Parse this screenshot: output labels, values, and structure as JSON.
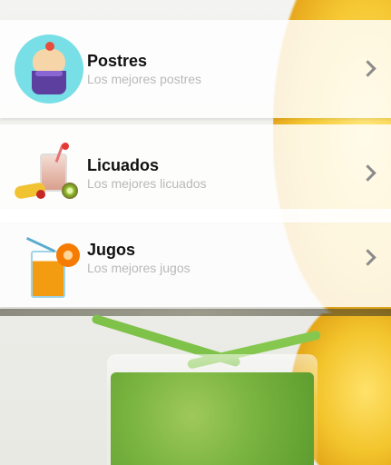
{
  "categories": [
    {
      "title": "Postres",
      "subtitle": "Los mejores postres",
      "icon": "cupcake-icon"
    },
    {
      "title": "Licuados",
      "subtitle": "Los mejores licuados",
      "icon": "smoothie-icon"
    },
    {
      "title": "Jugos",
      "subtitle": "Los mejores jugos",
      "icon": "juice-icon"
    }
  ],
  "chevron_icon": "chevron-right-icon"
}
